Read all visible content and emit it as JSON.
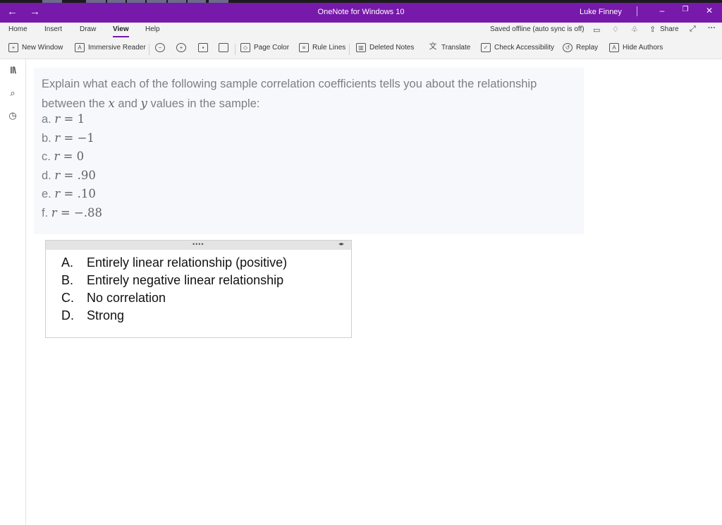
{
  "titlebar": {
    "back_icon": "←",
    "forward_icon": "→",
    "title": "OneNote for Windows 10",
    "user": "Luke Finney",
    "minimize": "–",
    "restore": "❐",
    "close": "✕",
    "accent": "#7719aa"
  },
  "tabs": {
    "items": [
      "Home",
      "Insert",
      "Draw",
      "View",
      "Help"
    ],
    "active": "View",
    "status": "Saved offline (auto sync is off)",
    "share": "Share",
    "more": "···"
  },
  "ribbon": {
    "new_window": "New Window",
    "immersive_reader": "Immersive Reader",
    "page_color": "Page Color",
    "rule_lines": "Rule Lines",
    "deleted_notes": "Deleted Notes",
    "translate": "Translate",
    "check_accessibility": "Check Accessibility",
    "replay": "Replay",
    "hide_authors": "Hide Authors"
  },
  "question": {
    "line1": "Explain what each of the following sample correlation coefficients tells you about the relationship",
    "line2_pre": "between the",
    "var_x": "x",
    "line2_mid": "and",
    "var_y": "y",
    "line2_post": "values in the sample:",
    "items": [
      {
        "label": "a.",
        "var": "r",
        "rel": " = ",
        "value": "1"
      },
      {
        "label": "b.",
        "var": "r",
        "rel": " = ",
        "value": "−1"
      },
      {
        "label": "c.",
        "var": "r",
        "rel": " = ",
        "value": "0"
      },
      {
        "label": "d.",
        "var": "r",
        "rel": " = ",
        "value": ".90"
      },
      {
        "label": "e.",
        "var": "r",
        "rel": " = ",
        "value": ".10"
      },
      {
        "label": "f.",
        "var": "r",
        "rel": " = ",
        "value": "−.88"
      }
    ]
  },
  "answers": {
    "dots": "••••",
    "arrows": "◂▸",
    "items": [
      {
        "letter": "A.",
        "text": "Entirely linear relationship (positive)"
      },
      {
        "letter": "B.",
        "text": "Entirely negative linear relationship"
      },
      {
        "letter": "C.",
        "text": "No correlation"
      },
      {
        "letter": "D.",
        "text": "Strong"
      }
    ]
  }
}
